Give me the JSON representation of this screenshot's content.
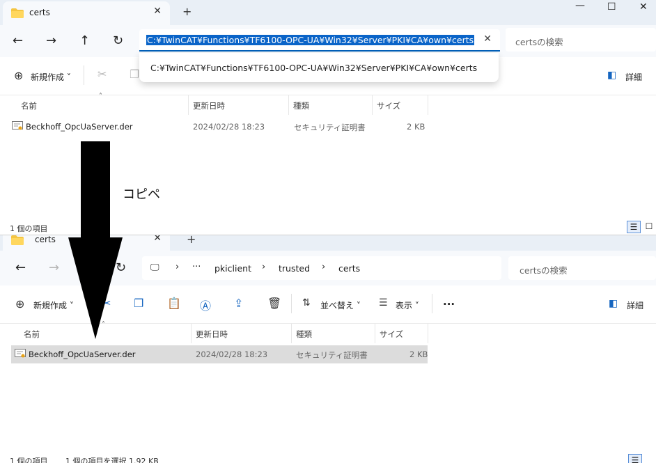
{
  "top_window": {
    "tab_title": "certs",
    "address_value": "C:¥TwinCAT¥Functions¥TF6100-OPC-UA¥Win32¥Server¥PKI¥CA¥own¥certs",
    "suggestion": "C:¥TwinCAT¥Functions¥TF6100-OPC-UA¥Win32¥Server¥PKI¥CA¥own¥certs",
    "search_placeholder": "certsの検索",
    "toolbar": {
      "new_label": "新規作成",
      "details_label": "詳細"
    },
    "columns": {
      "name": "名前",
      "date": "更新日時",
      "type": "種類",
      "size": "サイズ"
    },
    "files": [
      {
        "name": "Beckhoff_OpcUaServer.der",
        "date": "2024/02/28 18:23",
        "type": "セキュリティ証明書",
        "size": "2 KB"
      }
    ],
    "status": "1 個の項目"
  },
  "bottom_window": {
    "tab_title": "certs",
    "breadcrumb": {
      "more": "···",
      "items": [
        "pkiclient",
        "trusted",
        "certs"
      ]
    },
    "search_placeholder": "certsの検索",
    "toolbar": {
      "new_label": "新規作成",
      "sort_label": "並べ替え",
      "view_label": "表示",
      "more_label": "···",
      "details_label": "詳細"
    },
    "columns": {
      "name": "名前",
      "date": "更新日時",
      "type": "種類",
      "size": "サイズ"
    },
    "files": [
      {
        "name": "Beckhoff_OpcUaServer.der",
        "date": "2024/02/28 18:23",
        "type": "セキュリティ証明書",
        "size": "2 KB"
      }
    ],
    "status_count": "1 個の項目",
    "status_selected": "1 個の項目を選択  1.92 KB"
  },
  "annotation": {
    "text": "コピペ"
  },
  "colors": {
    "accent": "#005fb8",
    "selection": "#0a64c8",
    "titlebar": "#e9eff6"
  }
}
